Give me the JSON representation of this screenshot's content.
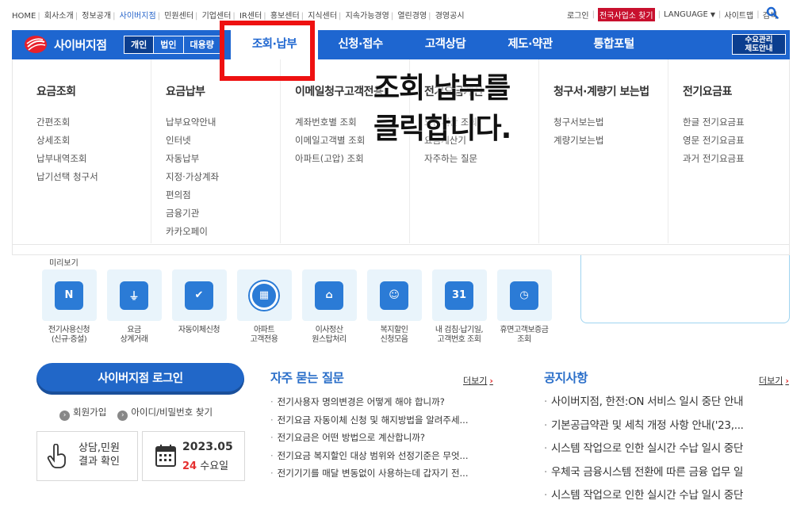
{
  "util_left": [
    "HOME",
    "회사소개",
    "정보공개",
    "사이버지점",
    "민원센터",
    "기업센터",
    "IR센터",
    "홍보센터",
    "지식센터",
    "지속가능경영",
    "열린경영",
    "경영공시"
  ],
  "util_right": {
    "login": "로그인",
    "find_office": "전국사업소 찾기",
    "language": "LANGUAGE",
    "sitemap": "사이트맵",
    "search": "검색"
  },
  "gnb": {
    "brand": "사이버지점",
    "segments": [
      "개인",
      "법인",
      "대용량"
    ],
    "menu": [
      "조회·납부",
      "신청·접수",
      "고객상담",
      "제도·약관",
      "통합포털"
    ],
    "demand_btn": [
      "수요관리",
      "제도안내"
    ]
  },
  "mega_menu": [
    {
      "title": "요금조회",
      "items": [
        "간편조회",
        "상세조회",
        "납부내역조회",
        "납기선택 청구서"
      ]
    },
    {
      "title": "요금납부",
      "items": [
        "납부요약안내",
        "인터넷",
        "자동납부",
        "지정·가상계좌",
        "편의점",
        "금융기관",
        "카카오페이"
      ]
    },
    {
      "title": "이메일청구고객전용",
      "items": [
        "계좌번호별 조회",
        "이메일고객별 조회",
        "아파트(고압) 조회"
      ]
    },
    {
      "title": "전기요금계산",
      "items": [
        "요금계산 조회",
        "요금계산기",
        "자주하는 질문"
      ]
    },
    {
      "title": "청구서·계량기 보는법",
      "items": [
        "청구서보는법",
        "계량기보는법"
      ]
    },
    {
      "title": "전기요금표",
      "items": [
        "한글 전기요금표",
        "영문 전기요금표",
        "과거 전기요금표"
      ]
    }
  ],
  "instruction": [
    "조회 납부를",
    "클릭합니다."
  ],
  "quick_title": "미리보기",
  "quick_menu": [
    {
      "icon": "N",
      "label": [
        "전기사용신청",
        "(신규·증설)"
      ]
    },
    {
      "icon": "plug",
      "label": [
        "요금",
        "상계거래"
      ]
    },
    {
      "icon": "check",
      "label": [
        "자동이체신청",
        ""
      ]
    },
    {
      "icon": "apt",
      "label": [
        "아파트",
        "고객전용"
      ]
    },
    {
      "icon": "home",
      "label": [
        "이사정산",
        "원스탑처리"
      ]
    },
    {
      "icon": "person",
      "label": [
        "복지할인",
        "신청모음"
      ]
    },
    {
      "icon": "31",
      "label": [
        "내 검침·납기일,",
        "고객번호 조회"
      ]
    },
    {
      "icon": "clock",
      "label": [
        "휴면고객보증금",
        "조회"
      ]
    }
  ],
  "login": {
    "button": "사이버지점 로그인",
    "join": "회원가입",
    "find": "아이디/비밀번호 찾기",
    "consult": [
      "상담,민원",
      "결과 확인"
    ],
    "date": "2023.05",
    "day_num": "24",
    "day_name": "수요일"
  },
  "faq": {
    "title": "자주 묻는 질문",
    "more": "더보기",
    "items": [
      "전기사용자 명의변경은 어떻게 해야 합니까?",
      "전기요금 자동이체 신청 및 해지방법을 알려주세...",
      "전기요금은 어떤 방법으로 계산합니까?",
      "전기요금 복지할인 대상 범위와 선정기준은 무엇...",
      "전기기기를 매달 변동없이 사용하는데 갑자기 전..."
    ]
  },
  "notice": {
    "title": "공지사항",
    "more": "더보기",
    "items": [
      "사이버지점, 한전:ON 서비스 일시 중단 안내",
      "기본공급약관 및 세칙 개정 사항 안내('23,...",
      "시스템 작업으로 인한 실시간 수납 일시 중단",
      "우체국 금융시스템 전환에 따른 금융 업무 일",
      "시스템 작업으로 인한 실시간 수납 일시 중단"
    ]
  },
  "colors": {
    "brand_blue": "#1e66d0",
    "highlight": "#ee1111",
    "accent_red": "#e53030"
  }
}
